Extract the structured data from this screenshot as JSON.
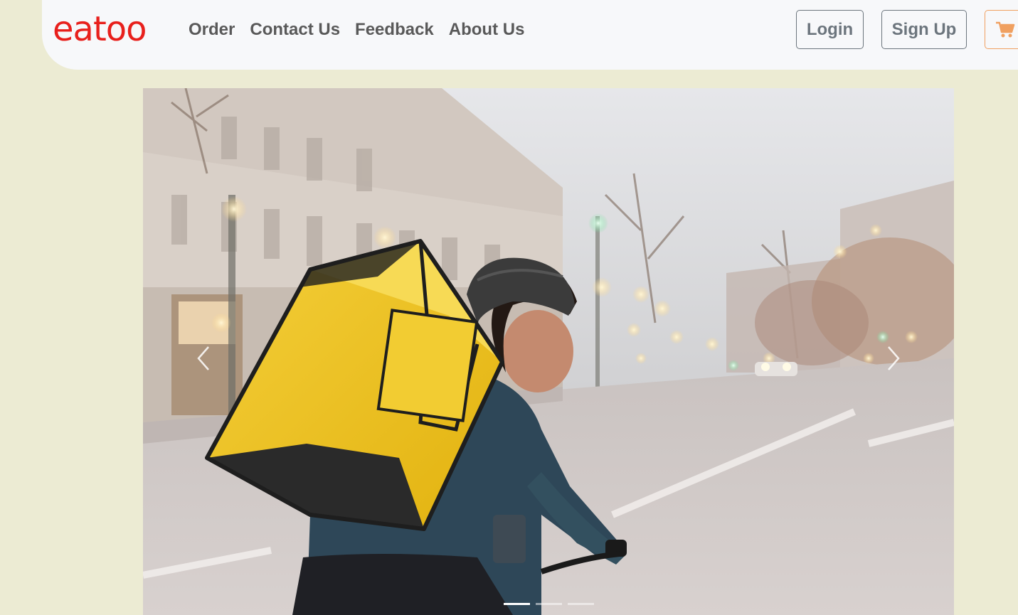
{
  "brand": {
    "logo_text": "eatoo",
    "logo_color": "#e8201c"
  },
  "nav": {
    "links": [
      {
        "label": "Order"
      },
      {
        "label": "Contact Us"
      },
      {
        "label": "Feedback"
      },
      {
        "label": "About Us"
      }
    ]
  },
  "auth": {
    "login_label": "Login",
    "signup_label": "Sign Up"
  },
  "cart": {
    "icon": "shopping-cart-icon",
    "accent_color": "#f0a060"
  },
  "carousel": {
    "slide_count": 3,
    "active_index": 0,
    "slide_subject": "delivery-cyclist-photo",
    "prev_icon": "chevron-left-icon",
    "next_icon": "chevron-right-icon"
  },
  "colors": {
    "page_background": "#ecebd3",
    "navbar_background": "#f7f8fa",
    "nav_text": "#595959",
    "button_outline": "#6c757d"
  }
}
